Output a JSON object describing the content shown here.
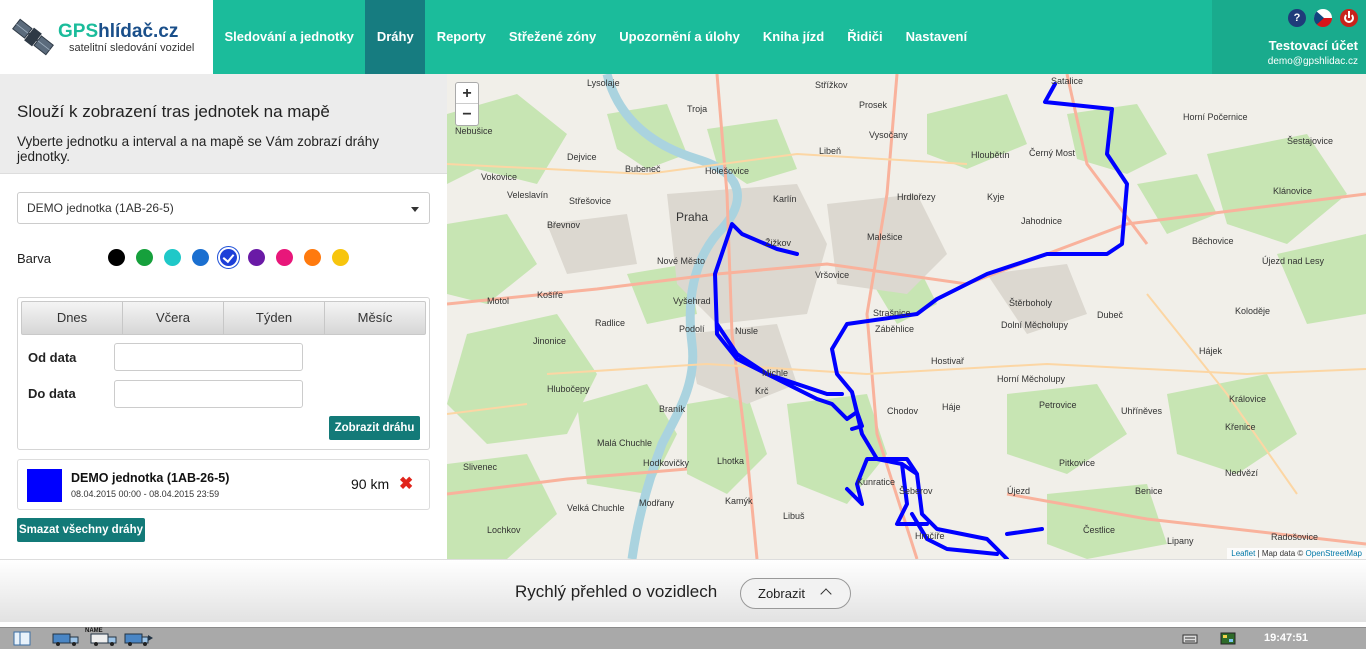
{
  "header": {
    "logo_title_prefix": "GPS",
    "logo_title_rest": "hlídač.cz",
    "logo_subtitle": "satelitní sledování vozidel",
    "nav": [
      {
        "label": "Sledování a jednotky",
        "active": false
      },
      {
        "label": "Dráhy",
        "active": true
      },
      {
        "label": "Reporty",
        "active": false
      },
      {
        "label": "Střežené zóny",
        "active": false
      },
      {
        "label": "Upozornění a úlohy",
        "active": false
      },
      {
        "label": "Kniha jízd",
        "active": false
      },
      {
        "label": "Řidiči",
        "active": false
      },
      {
        "label": "Nastavení",
        "active": false
      }
    ],
    "account_name": "Testovací účet",
    "account_email": "demo@gpshlidac.cz",
    "help_icon_text": "?"
  },
  "panel": {
    "heading": "Slouží k zobrazení tras jednotek na mapě",
    "description": "Vyberte jednotku a interval a na mapě se Vám zobrazí dráhy jednotky.",
    "unit_selected": "DEMO jednotka (1AB-26-5)",
    "color_label": "Barva",
    "colors": [
      "#000000",
      "#16a03c",
      "#1fc8c8",
      "#1b6fd0",
      "#1d3fd8",
      "#6a1aa6",
      "#e8177a",
      "#ff7a0e",
      "#f7c50d"
    ],
    "selected_color_index": 4,
    "tabs": [
      "Dnes",
      "Včera",
      "Týden",
      "Měsíc"
    ],
    "from_label": "Od data",
    "to_label": "Do data",
    "show_button": "Zobrazit dráhu",
    "route": {
      "name": "DEMO jednotka (1AB-26-5)",
      "dates": "08.04.2015 00:00 - 08.04.2015 23:59",
      "distance": "90 km",
      "color": "#0000ff",
      "delete_glyph": "✖"
    },
    "delete_all_button": "Smazat všechny dráhy"
  },
  "map": {
    "zoom_in": "+",
    "zoom_out": "−",
    "attribution_leaflet": "Leaflet",
    "attribution_rest": " | Map data © ",
    "attribution_osm": "OpenStreetMap",
    "labels_big": [
      {
        "text": "Praha"
      }
    ],
    "labels": [
      {
        "text": "Lysolaje"
      },
      {
        "text": "Troja"
      },
      {
        "text": "Střížkov"
      },
      {
        "text": "Prosek"
      },
      {
        "text": "Satalice"
      },
      {
        "text": "Nebušice"
      },
      {
        "text": "Dejvice"
      },
      {
        "text": "Bubeneč"
      },
      {
        "text": "Holešovice"
      },
      {
        "text": "Libeň"
      },
      {
        "text": "Vysočany"
      },
      {
        "text": "Hloubětín"
      },
      {
        "text": "Černý Most"
      },
      {
        "text": "Horní Počernice"
      },
      {
        "text": "Šestajovice"
      },
      {
        "text": "Vokovice"
      },
      {
        "text": "Veleslavín"
      },
      {
        "text": "Střešovice"
      },
      {
        "text": "Karlín"
      },
      {
        "text": "Hrdlořezy"
      },
      {
        "text": "Kyje"
      },
      {
        "text": "Klánovice"
      },
      {
        "text": "Břevnov"
      },
      {
        "text": "Žižkov"
      },
      {
        "text": "Malešice"
      },
      {
        "text": "Jahodnice"
      },
      {
        "text": "Běchovice"
      },
      {
        "text": "Nové Město"
      },
      {
        "text": "Vršovice"
      },
      {
        "text": "Štěrboholy"
      },
      {
        "text": "Újezd nad Lesy"
      },
      {
        "text": "Motol"
      },
      {
        "text": "Košíře"
      },
      {
        "text": "Vyšehrad"
      },
      {
        "text": "Strašnice"
      },
      {
        "text": "Radlice"
      },
      {
        "text": "Podolí"
      },
      {
        "text": "Nusle"
      },
      {
        "text": "Záběhlice"
      },
      {
        "text": "Dolní Měcholupy"
      },
      {
        "text": "Dubeč"
      },
      {
        "text": "Koloděje"
      },
      {
        "text": "Jinonice"
      },
      {
        "text": "Hostivař"
      },
      {
        "text": "Hájek"
      },
      {
        "text": "Michle"
      },
      {
        "text": "Hlubočepy"
      },
      {
        "text": "Krč"
      },
      {
        "text": "Horní Měcholupy"
      },
      {
        "text": "Uhříněves"
      },
      {
        "text": "Královice"
      },
      {
        "text": "Braník"
      },
      {
        "text": "Chodov"
      },
      {
        "text": "Háje"
      },
      {
        "text": "Petrovice"
      },
      {
        "text": "Křenice"
      },
      {
        "text": "Malá Chuchle"
      },
      {
        "text": "Lhotka"
      },
      {
        "text": "Pitkovice"
      },
      {
        "text": "Slivenec"
      },
      {
        "text": "Hodkovičky"
      },
      {
        "text": "Kunratice"
      },
      {
        "text": "Šeberov"
      },
      {
        "text": "Újezd"
      },
      {
        "text": "Benice"
      },
      {
        "text": "Nedvězí"
      },
      {
        "text": "Kamýk"
      },
      {
        "text": "Velká Chuchle"
      },
      {
        "text": "Modřany"
      },
      {
        "text": "Libuš"
      },
      {
        "text": "Hrnčíře"
      },
      {
        "text": "Lochkov"
      },
      {
        "text": "Čestlice"
      },
      {
        "text": "Lipany"
      },
      {
        "text": "Radošovice"
      }
    ]
  },
  "bottom": {
    "title": "Rychlý přehled o vozidlech",
    "button": "Zobrazit"
  },
  "taskbar": {
    "time": "19:47:51",
    "truck_label": "NAME"
  }
}
